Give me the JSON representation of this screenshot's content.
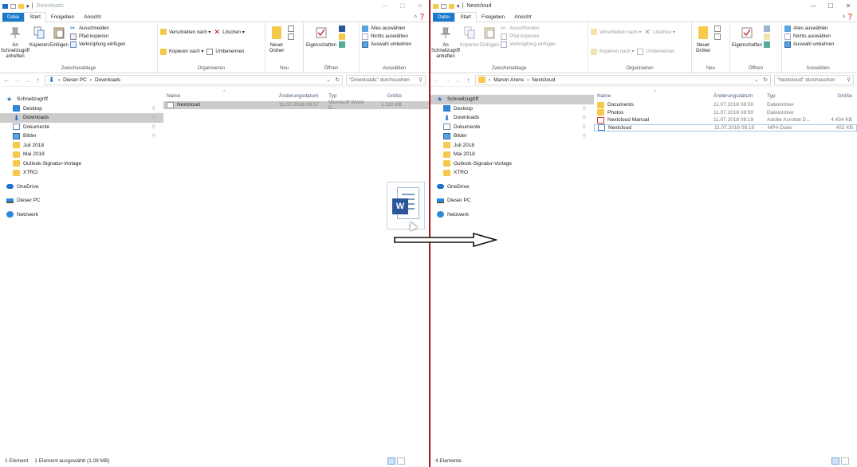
{
  "left": {
    "title": "Downloads",
    "tabs": {
      "file": "Datei",
      "start": "Start",
      "share": "Freigeben",
      "view": "Ansicht"
    },
    "ribbon": {
      "pin_label": "An Schnellzugriff anheften",
      "copy_label": "Kopieren",
      "paste_label": "Einfügen",
      "cut_label": "Ausschneiden",
      "copy_path_label": "Pfad kopieren",
      "paste_shortcut_label": "Verknüpfung einfügen",
      "clipboard_group": "Zwischenablage",
      "move_to_label": "Verschieben nach ▾",
      "copy_to_label": "Kopieren nach ▾",
      "delete_label": "Löschen ▾",
      "rename_label": "Umbenennen",
      "organize_group": "Organisieren",
      "new_folder_label": "Neuer Ordner",
      "new_group": "Neu",
      "properties_label": "Eigenschaften",
      "open_group": "Öffnen",
      "select_all_label": "Alles auswählen",
      "select_none_label": "Nichts auswählen",
      "invert_selection_label": "Auswahl umkehren",
      "select_group": "Auswählen"
    },
    "address": {
      "path1": "Dieser PC",
      "path2": "Downloads",
      "search_placeholder": "\"Downloads\" durchsuchen"
    },
    "columns": {
      "name": "Name",
      "date": "Änderungsdatum",
      "type": "Typ",
      "size": "Größe"
    },
    "files": [
      {
        "name": "Nextcloud",
        "date": "11.07.2018 08:57",
        "type": "Microsoft Word-D...",
        "size": "1.110 KB"
      }
    ],
    "status": {
      "count": "1 Element",
      "selected": "1 Element ausgewählt (1,08 MB)"
    }
  },
  "right": {
    "title": "Nextcloud",
    "tabs": {
      "file": "Datei",
      "start": "Start",
      "share": "Freigeben",
      "view": "Ansicht"
    },
    "ribbon": {
      "pin_label": "An Schnellzugriff anheften",
      "copy_label": "Kopieren",
      "paste_label": "Einfügen",
      "cut_label": "Ausschneiden",
      "copy_path_label": "Pfad kopieren",
      "paste_shortcut_label": "Verknüpfung einfügen",
      "clipboard_group": "Zwischenablage",
      "move_to_label": "Verschieben nach ▾",
      "copy_to_label": "Kopieren nach ▾",
      "delete_label": "Löschen ▾",
      "rename_label": "Umbenennen",
      "organize_group": "Organisieren",
      "new_folder_label": "Neuer Ordner",
      "new_group": "Neu",
      "properties_label": "Eigenschaften",
      "open_group": "Öffnen",
      "select_all_label": "Alles auswählen",
      "select_none_label": "Nichts auswählen",
      "invert_selection_label": "Auswahl umkehren",
      "select_group": "Auswählen"
    },
    "address": {
      "path1": "Marvin Arens",
      "path2": "Nextcloud",
      "search_placeholder": "\"Nextcloud\" durchsuchen"
    },
    "columns": {
      "name": "Name",
      "date": "Änderungsdatum",
      "type": "Typ",
      "size": "Größe"
    },
    "files": [
      {
        "name": "Documents",
        "date": "11.07.2018 08:50",
        "type": "Dateiordner",
        "size": ""
      },
      {
        "name": "Photos",
        "date": "11.07.2018 08:50",
        "type": "Dateiordner",
        "size": ""
      },
      {
        "name": "Nextcloud Manual",
        "date": "11.07.2018 08:19",
        "type": "Adobe Acrobat D...",
        "size": "4.434 KB"
      },
      {
        "name": "Nextcloud",
        "date": "11.07.2018 08:19",
        "type": "MP4-Datei",
        "size": "452 KB"
      }
    ],
    "status": {
      "count": "4 Elemente"
    }
  },
  "nav": {
    "quick_access": "Schnellzugriff",
    "desktop": "Desktop",
    "downloads": "Downloads",
    "documents": "Dokumente",
    "pictures": "Bilder",
    "juli": "Juli 2018",
    "mai": "Mai 2018",
    "outlook": "Outlook-Signatur-Vorlage",
    "xtro": "XTRO",
    "onedrive": "OneDrive",
    "this_pc": "Dieser PC",
    "network": "Netzwerk"
  },
  "drag": {
    "icon": "word-icon",
    "letter": "W"
  },
  "colors": {
    "accent": "#1979ca",
    "splitter": "#a4161a",
    "folder": "#f5c94c"
  }
}
